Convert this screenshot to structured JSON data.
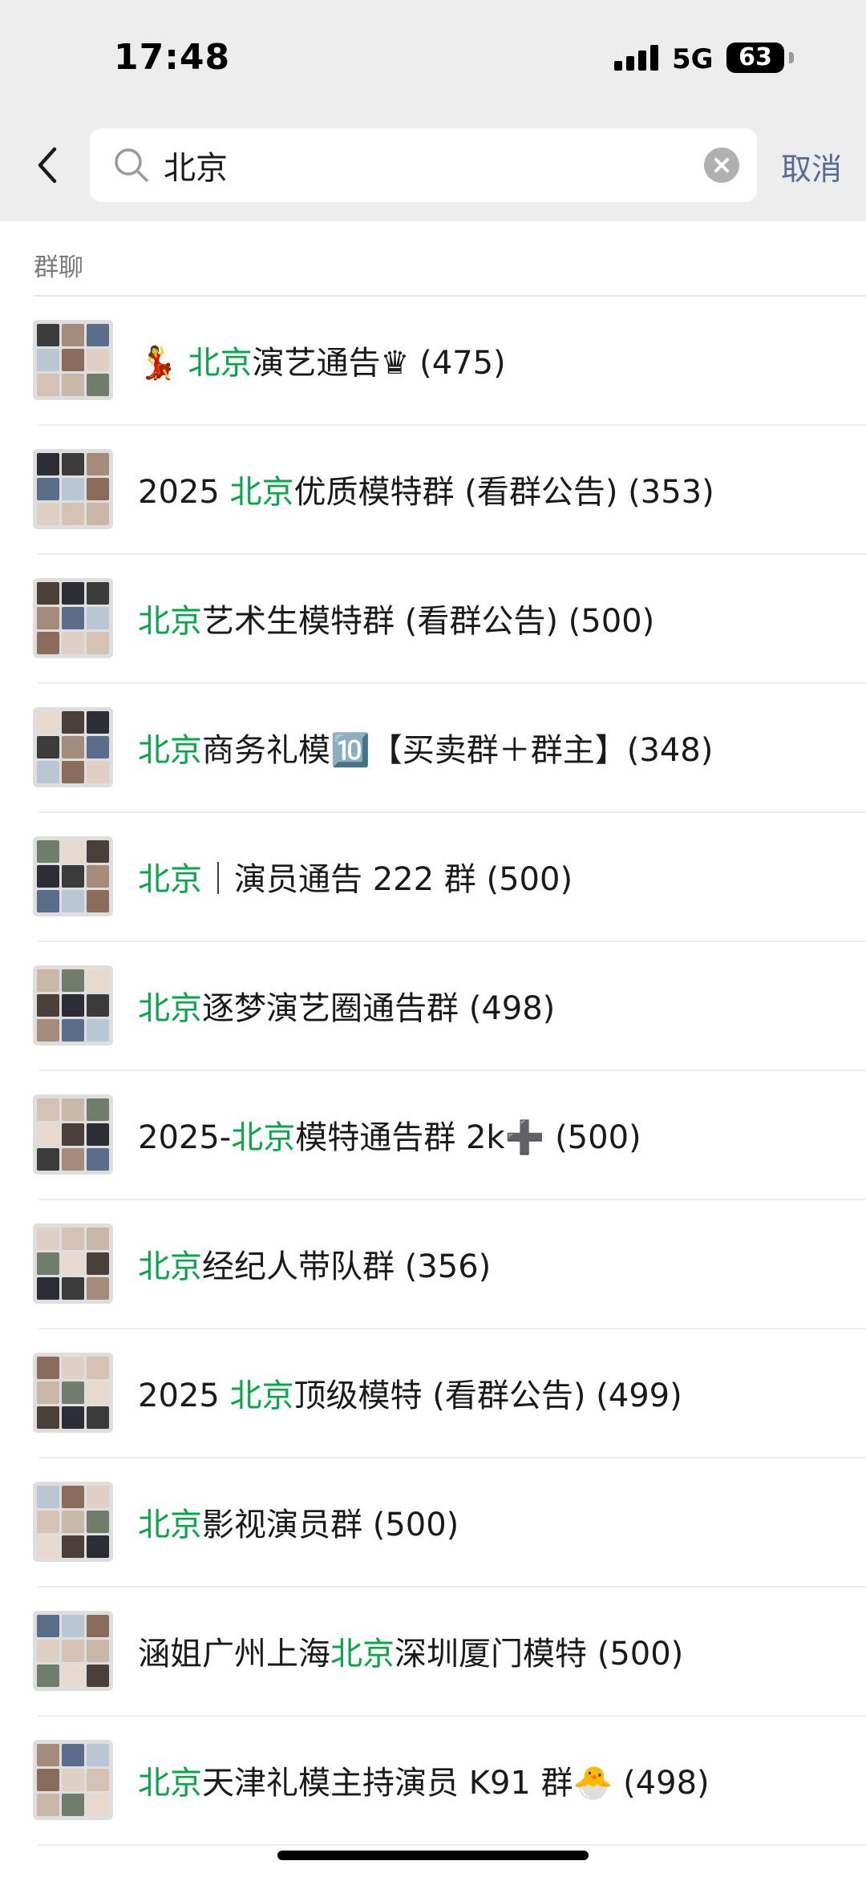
{
  "status_bar": {
    "time": "17:48",
    "network": "5G",
    "battery": "63"
  },
  "search": {
    "query": "北京",
    "placeholder": "",
    "cancel_label": "取消"
  },
  "section": {
    "title": "群聊"
  },
  "accent_color": "#07a64a",
  "link_color": "#576b95",
  "results": [
    {
      "prefix": "💃 ",
      "match": "北京",
      "suffix": "演艺通告♛ (475)"
    },
    {
      "prefix": "2025 ",
      "match": "北京",
      "suffix": "优质模特群 (看群公告) (353)"
    },
    {
      "prefix": "",
      "match": "北京",
      "suffix": "艺术生模特群 (看群公告) (500)"
    },
    {
      "prefix": "",
      "match": "北京",
      "suffix": "商务礼模🔟【买卖群＋群主】(348)"
    },
    {
      "prefix": "",
      "match": "北京",
      "suffix": "｜演员通告 222 群 (500)"
    },
    {
      "prefix": "",
      "match": "北京",
      "suffix": "逐梦演艺圈通告群 (498)"
    },
    {
      "prefix": "2025-",
      "match": "北京",
      "suffix": "模特通告群 2k➕ (500)"
    },
    {
      "prefix": "",
      "match": "北京",
      "suffix": "经纪人带队群 (356)"
    },
    {
      "prefix": "2025 ",
      "match": "北京",
      "suffix": "顶级模特 (看群公告) (499)"
    },
    {
      "prefix": "",
      "match": "北京",
      "suffix": "影视演员群 (500)"
    },
    {
      "prefix": "涵姐广州上海",
      "match": "北京",
      "suffix": "深圳厦门模特 (500)"
    },
    {
      "prefix": "",
      "match": "北京",
      "suffix": "天津礼模主持演员 K91 群🐣 (498)"
    }
  ]
}
